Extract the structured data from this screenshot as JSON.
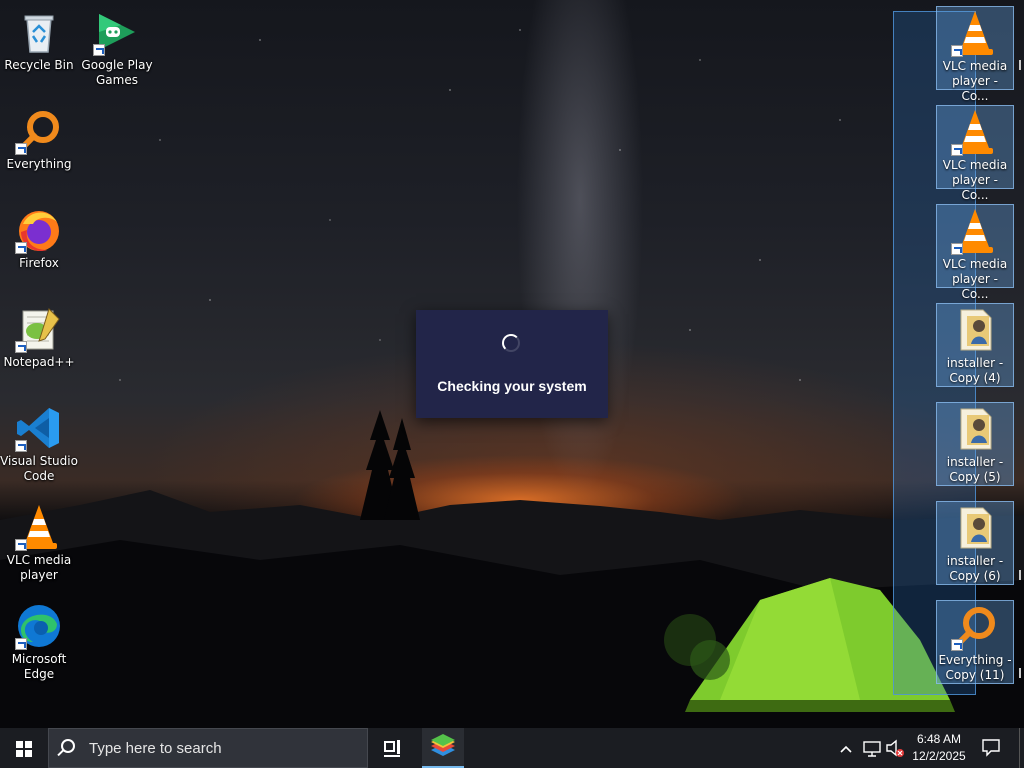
{
  "desktop": {
    "left_icons": [
      {
        "label": "Recycle Bin",
        "icon": "recycle-bin-icon"
      },
      {
        "label": "Google Play Games",
        "icon": "google-play-games-icon"
      },
      {
        "label": "Everything",
        "icon": "everything-search-icon"
      },
      {
        "label": "Firefox",
        "icon": "firefox-icon"
      },
      {
        "label": "Notepad++",
        "icon": "notepad-plus-plus-icon"
      },
      {
        "label": "Visual Studio Code",
        "icon": "vscode-icon"
      },
      {
        "label": "VLC media player",
        "icon": "vlc-icon"
      },
      {
        "label": "Microsoft Edge",
        "icon": "edge-icon"
      }
    ],
    "right_icons": [
      {
        "label": "VLC media player - Co...",
        "icon": "vlc-icon"
      },
      {
        "label": "VLC media player - Co...",
        "icon": "vlc-icon"
      },
      {
        "label": "VLC media player - Co...",
        "icon": "vlc-icon"
      },
      {
        "label": "installer - Copy (4)",
        "icon": "installer-icon"
      },
      {
        "label": "installer - Copy (5)",
        "icon": "installer-icon"
      },
      {
        "label": "installer - Copy (6)",
        "icon": "installer-icon"
      },
      {
        "label": "Everything - Copy (11)",
        "icon": "everything-search-icon"
      }
    ]
  },
  "dialog": {
    "message": "Checking your system",
    "icon": "loading-spinner-icon"
  },
  "taskbar": {
    "search_placeholder": "Type here to search",
    "pinned_app": "bluestacks-icon",
    "clock_time": "6:48 AM",
    "clock_date": "12/2/2025",
    "colors": {
      "taskbar_bg": "#1b1d22",
      "accent": "#76b9ed",
      "dialog_bg": "#222549"
    }
  }
}
